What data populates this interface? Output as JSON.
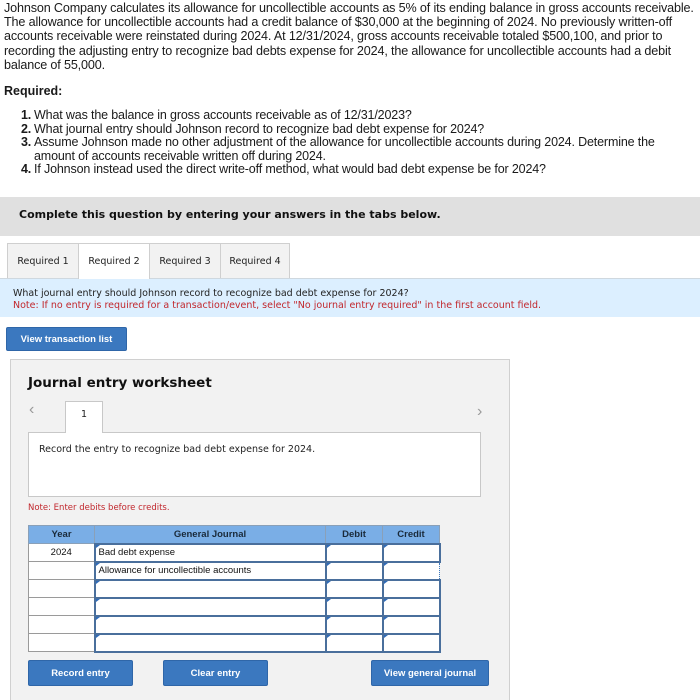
{
  "problem": {
    "intro": "Johnson Company calculates its allowance for uncollectible accounts as 5% of its ending balance in gross accounts receivable. The allowance for uncollectible accounts had a credit balance of $30,000 at the beginning of 2024. No previously written-off accounts receivable were reinstated during 2024. At 12/31/2024, gross accounts receivable totaled $500,100, and prior to recording the adjusting entry to recognize bad debts expense for 2024, the allowance for uncollectible accounts had a debit balance of 55,000.",
    "required_title": "Required:",
    "required_items": [
      {
        "num": "1.",
        "text": "What was the balance in gross accounts receivable as of 12/31/2023?"
      },
      {
        "num": "2.",
        "text": "What journal entry should Johnson record to recognize bad debt expense for 2024?"
      },
      {
        "num": "3.",
        "text": "Assume Johnson made no other adjustment of the allowance for uncollectible accounts during 2024. Determine the amount of accounts receivable written off during 2024."
      },
      {
        "num": "4.",
        "text": "If Johnson instead used the direct write-off method, what would bad debt expense be for 2024?"
      }
    ]
  },
  "complete_bar": "Complete this question by entering your answers in the tabs below.",
  "tabs": [
    {
      "label": "Required 1",
      "active": false
    },
    {
      "label": "Required 2",
      "active": true
    },
    {
      "label": "Required 3",
      "active": false
    },
    {
      "label": "Required 4",
      "active": false
    }
  ],
  "info": {
    "question": "What journal entry should Johnson record to recognize bad debt expense for 2024?",
    "note": "Note: If no entry is required for a transaction/event, select \"No journal entry required\" in the first account field."
  },
  "buttons": {
    "view_transaction_list": "View transaction list",
    "record_entry": "Record entry",
    "clear_entry": "Clear entry",
    "view_general_journal": "View general journal"
  },
  "worksheet": {
    "title": "Journal entry worksheet",
    "prev_icon": "‹",
    "next_icon": "›",
    "current_tab": "1",
    "instruction": "Record the entry to recognize bad debt expense for 2024.",
    "note": "Note: Enter debits before credits.",
    "headers": {
      "year": "Year",
      "journal": "General Journal",
      "debit": "Debit",
      "credit": "Credit"
    },
    "rows": [
      {
        "year": "2024",
        "account": "Bad debt expense",
        "debit": "",
        "credit": ""
      },
      {
        "year": "",
        "account": "Allowance for uncollectible accounts",
        "debit": "",
        "credit": ""
      },
      {
        "year": "",
        "account": "",
        "debit": "",
        "credit": ""
      },
      {
        "year": "",
        "account": "",
        "debit": "",
        "credit": ""
      },
      {
        "year": "",
        "account": "",
        "debit": "",
        "credit": ""
      },
      {
        "year": "",
        "account": "",
        "debit": "",
        "credit": ""
      }
    ]
  }
}
